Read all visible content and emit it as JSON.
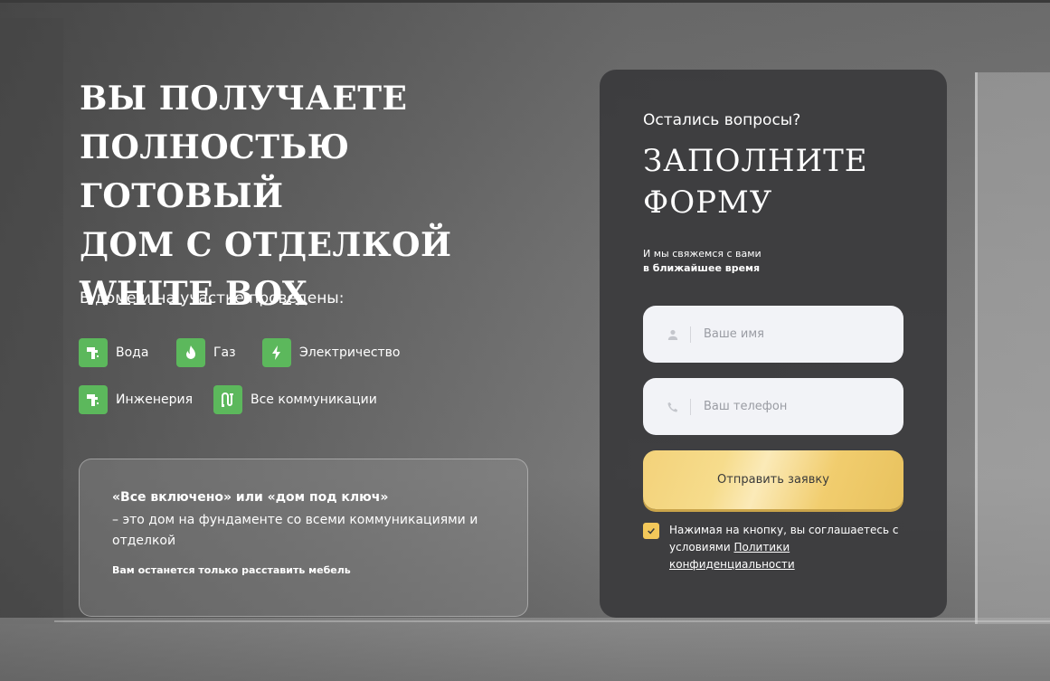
{
  "hero": {
    "headline": "ВЫ ПОЛУЧАЕТЕ\nПОЛНОСТЬЮ ГОТОВЫЙ\nДОМ С ОТДЕЛКОЙ\nWHITE BOX",
    "subtitle": "В доме и на участке проведены:"
  },
  "features": [
    {
      "label": "Вода",
      "icon": "faucet-icon"
    },
    {
      "label": "Газ",
      "icon": "flame-icon"
    },
    {
      "label": "Электричество",
      "icon": "lightning-icon"
    },
    {
      "label": "Инженерия",
      "icon": "faucet-icon"
    },
    {
      "label": "Все коммуникации",
      "icon": "pipes-icon"
    }
  ],
  "info": {
    "question": "«Все включено» или «дом под ключ»",
    "description": "– это дом на фундаменте со всеми коммуникациями и отделкой",
    "note": "Вам останется только расставить мебель"
  },
  "form": {
    "small_question": "Остались вопросы?",
    "title": "ЗАПОЛНИТЕ ФОРМУ",
    "callback_line1": "И мы свяжемся с вами",
    "callback_line2": "в ближайшее время",
    "name_placeholder": "Ваше имя",
    "phone_placeholder": "Ваш телефон",
    "submit_label": "Отправить заявку",
    "consent_text": "Нажимая на кнопку, вы соглашаетесь с условиями",
    "consent_link": "Политики конфиденциальности",
    "consent_checked": true
  },
  "colors": {
    "accent_green": "#5cb85c",
    "accent_gold": "#f3c85a",
    "form_bg": "#3a3a3c"
  }
}
